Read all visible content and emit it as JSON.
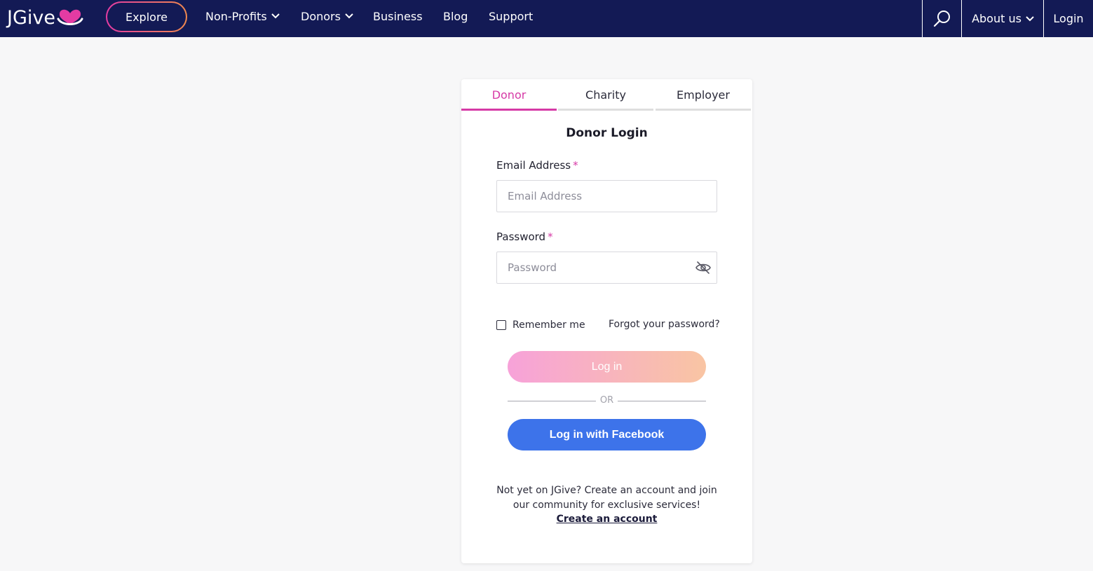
{
  "nav": {
    "logo_text": "JGive",
    "explore": "Explore",
    "items": [
      {
        "label": "Non-Profits",
        "has_dropdown": true
      },
      {
        "label": "Donors",
        "has_dropdown": true
      },
      {
        "label": "Business",
        "has_dropdown": false
      },
      {
        "label": "Blog",
        "has_dropdown": false
      },
      {
        "label": "Support",
        "has_dropdown": false
      }
    ],
    "search_icon": "search-icon",
    "about": "About us",
    "login": "Login"
  },
  "tabs": [
    {
      "label": "Donor",
      "active": true
    },
    {
      "label": "Charity",
      "active": false
    },
    {
      "label": "Employer",
      "active": false
    }
  ],
  "form": {
    "title": "Donor Login",
    "email_label": "Email Address",
    "email_placeholder": "Email Address",
    "email_value": "",
    "password_label": "Password",
    "password_placeholder": "Password",
    "password_value": "",
    "required_mark": "*",
    "remember_label": "Remember me",
    "remember_checked": false,
    "forgot_label": "Forgot your password?",
    "login_button": "Log in",
    "or_text": "OR",
    "facebook_button": "Log in with Facebook",
    "signup_line1": "Not yet on JGive? Create an account and join",
    "signup_line2": "our community for exclusive services!",
    "signup_link": "Create an account"
  },
  "colors": {
    "nav_bg": "#131a55",
    "accent_pink": "#d63aa6",
    "facebook_blue": "#3d73ea",
    "login_gradient_start": "#f7a2d9",
    "login_gradient_end": "#f9c5a3",
    "page_bg": "#f7f7f8"
  }
}
